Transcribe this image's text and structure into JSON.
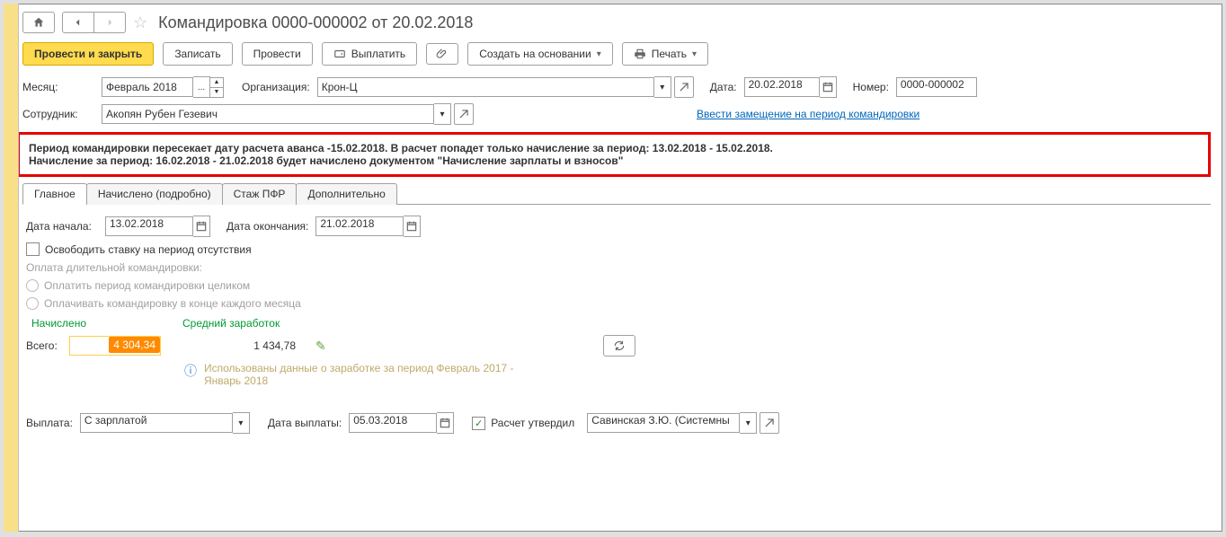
{
  "header": {
    "title": "Командировка 0000-000002 от 20.02.2018"
  },
  "toolbar": {
    "post_close": "Провести и закрыть",
    "save": "Записать",
    "post": "Провести",
    "pay": "Выплатить",
    "create_based": "Создать на основании",
    "print": "Печать"
  },
  "fields": {
    "month_label": "Месяц:",
    "month_value": "Февраль 2018",
    "org_label": "Организация:",
    "org_value": "Крон-Ц",
    "date_label": "Дата:",
    "date_value": "20.02.2018",
    "number_label": "Номер:",
    "number_value": "0000-000002",
    "employee_label": "Сотрудник:",
    "employee_value": "Акопян Рубен Гезевич",
    "substitution_link": "Ввести замещение на период командировки"
  },
  "warning": {
    "line1": "Период командировки пересекает дату расчета аванса -15.02.2018. В расчет попадет только начисление за период: 13.02.2018 - 15.02.2018.",
    "line2": "Начисление за период: 16.02.2018 - 21.02.2018 будет начислено документом \"Начисление зарплаты и взносов\""
  },
  "tabs": [
    "Главное",
    "Начислено (подробно)",
    "Стаж ПФР",
    "Дополнительно"
  ],
  "main": {
    "start_label": "Дата начала:",
    "start_value": "13.02.2018",
    "end_label": "Дата окончания:",
    "end_value": "21.02.2018",
    "free_rate": "Освободить ставку на период отсутствия",
    "long_trip_label": "Оплата длительной командировки:",
    "radio_full": "Оплатить период командировки целиком",
    "radio_monthly": "Оплачивать командировку в конце каждого месяца",
    "accrued_head": "Начислено",
    "avg_head": "Средний заработок",
    "total_label": "Всего:",
    "total_value": "4 304,34",
    "avg_value": "1 434,78",
    "info_text": "Использованы данные о заработке за период Февраль 2017 - Январь 2018"
  },
  "footer": {
    "payout_label": "Выплата:",
    "payout_value": "С зарплатой",
    "payout_date_label": "Дата выплаты:",
    "payout_date_value": "05.03.2018",
    "approved_label": "Расчет утвердил",
    "approved_value": "Савинская З.Ю. (Системны"
  },
  "icons": {
    "ellipsis": "...",
    "down": "▼",
    "up": "▲",
    "cal": "📅"
  }
}
